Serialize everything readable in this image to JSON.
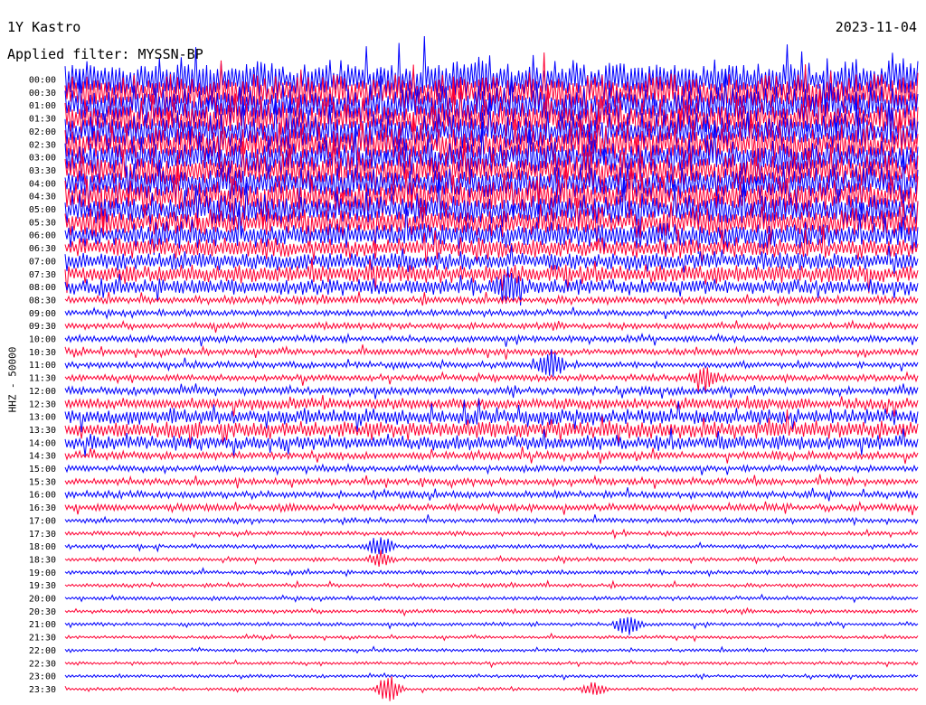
{
  "header": {
    "station": "1Y Kastro",
    "date": "2023-11-04",
    "filter_label": "Applied filter: MYSSN-BP"
  },
  "chart_data": {
    "type": "helicorder",
    "ylabel": "HHZ - 50000",
    "series_colors": [
      "#0000ff",
      "#ff0033"
    ],
    "row_labels": [
      "00:00",
      "00:30",
      "01:00",
      "01:30",
      "02:00",
      "02:30",
      "03:00",
      "03:30",
      "04:00",
      "04:30",
      "05:00",
      "05:30",
      "06:00",
      "06:30",
      "07:00",
      "07:30",
      "08:00",
      "08:30",
      "09:00",
      "09:30",
      "10:00",
      "10:30",
      "11:00",
      "11:30",
      "12:00",
      "12:30",
      "13:00",
      "13:30",
      "14:00",
      "14:30",
      "15:00",
      "15:30",
      "16:00",
      "16:30",
      "17:00",
      "17:30",
      "18:00",
      "18:30",
      "19:00",
      "19:30",
      "20:00",
      "20:30",
      "21:00",
      "21:30",
      "22:00",
      "22:30",
      "23:00",
      "23:30"
    ],
    "row_amplitude": [
      2.6,
      2.6,
      2.6,
      2.5,
      2.5,
      2.5,
      2.4,
      2.4,
      2.3,
      2.3,
      2.2,
      2.0,
      1.8,
      1.4,
      1.3,
      1.3,
      1.1,
      0.55,
      0.45,
      0.45,
      0.45,
      0.45,
      0.45,
      0.45,
      0.55,
      0.8,
      1.1,
      1.2,
      1.0,
      0.55,
      0.45,
      0.45,
      0.5,
      0.5,
      0.35,
      0.3,
      0.3,
      0.28,
      0.28,
      0.28,
      0.28,
      0.28,
      0.25,
      0.22,
      0.22,
      0.22,
      0.22,
      0.22
    ],
    "events": [
      {
        "row": 36,
        "time_frac": 0.37,
        "amp": 1.4
      },
      {
        "row": 37,
        "time_frac": 0.37,
        "amp": 1.0
      },
      {
        "row": 42,
        "time_frac": 0.66,
        "amp": 1.6
      },
      {
        "row": 47,
        "time_frac": 0.38,
        "amp": 1.8
      },
      {
        "row": 47,
        "time_frac": 0.62,
        "amp": 0.8
      },
      {
        "row": 16,
        "time_frac": 0.52,
        "amp": 2.0
      },
      {
        "row": 22,
        "time_frac": 0.57,
        "amp": 1.8
      },
      {
        "row": 23,
        "time_frac": 0.75,
        "amp": 1.5
      }
    ]
  }
}
